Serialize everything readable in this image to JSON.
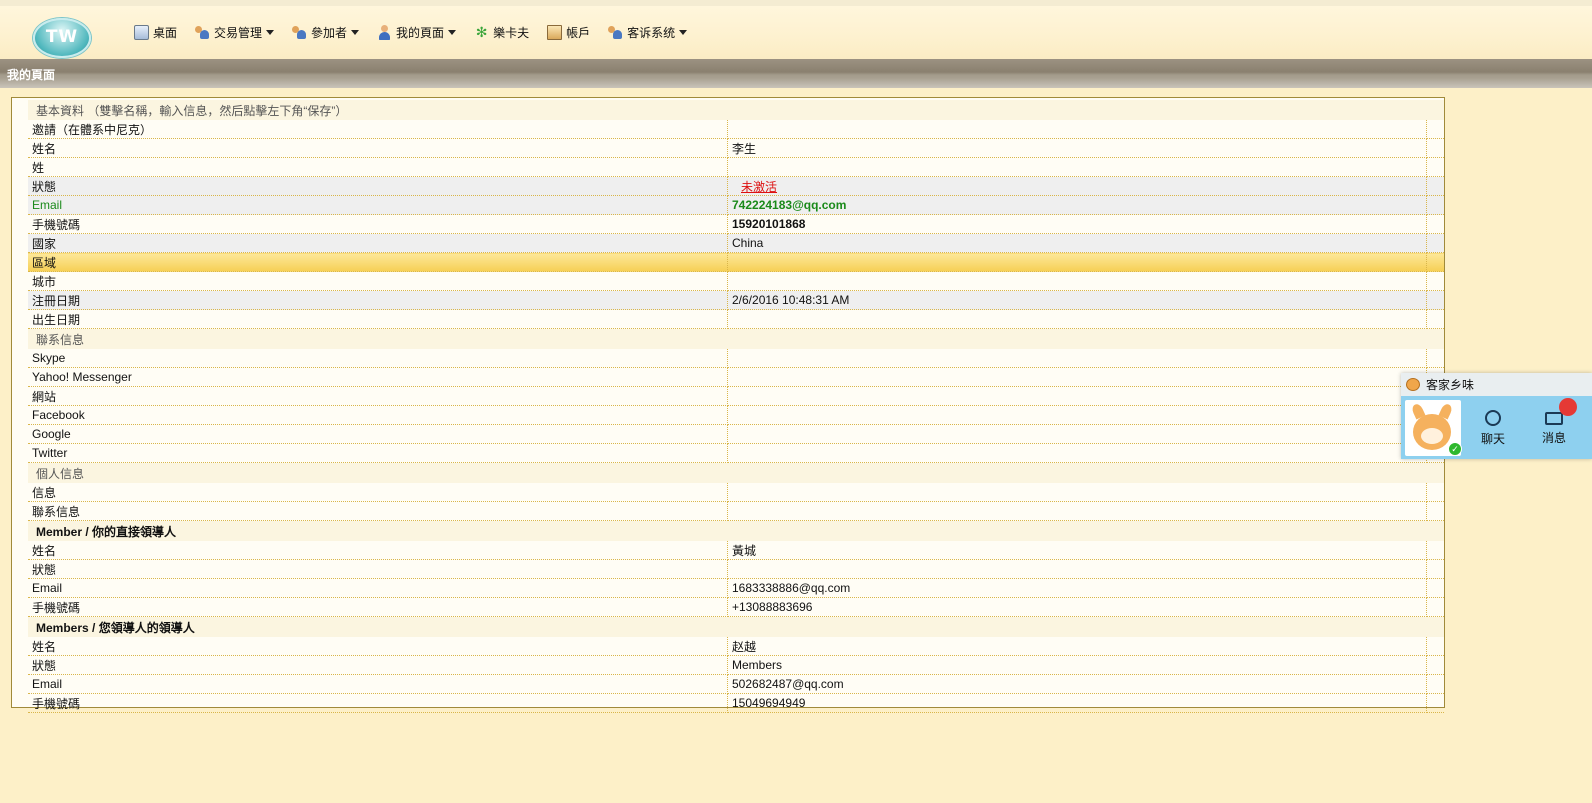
{
  "nav": {
    "logo": "TW",
    "items": [
      {
        "label": "桌面",
        "icon": "desktop-icon",
        "dropdown": false
      },
      {
        "label": "交易管理",
        "icon": "people-icon",
        "dropdown": true
      },
      {
        "label": "參加者",
        "icon": "people-icon",
        "dropdown": true
      },
      {
        "label": "我的頁面",
        "icon": "user-icon",
        "dropdown": true
      },
      {
        "label": "樂卡夫",
        "icon": "butterfly-icon",
        "dropdown": false
      },
      {
        "label": "帳戶",
        "icon": "account-icon",
        "dropdown": false
      },
      {
        "label": "客诉系统",
        "icon": "people-icon",
        "dropdown": true
      }
    ]
  },
  "page_title": "我的頁面",
  "sections": {
    "basic": "基本資料 （雙擊名稱，輸入信息，然后點擊左下角“保存”）",
    "contact": "聯系信息",
    "personal": "個人信息",
    "leader": "Member / 你的直接領導人",
    "leader2": "Members / 您領導人的領導人"
  },
  "basic_rows": [
    {
      "label": "邀請（在體系中尼克）",
      "value": ""
    },
    {
      "label": "姓名",
      "value": "李生"
    },
    {
      "label": "姓",
      "value": ""
    },
    {
      "label": "狀態",
      "value": "未激活"
    },
    {
      "label": "Email",
      "value": "742224183@qq.com"
    },
    {
      "label": "手機號碼",
      "value": "15920101868"
    },
    {
      "label": "國家",
      "value": "China"
    },
    {
      "label": "區域",
      "value": ""
    },
    {
      "label": "城市",
      "value": ""
    },
    {
      "label": "注冊日期",
      "value": "2/6/2016 10:48:31 AM"
    },
    {
      "label": "出生日期",
      "value": ""
    }
  ],
  "contact_rows": [
    {
      "label": "Skype",
      "value": ""
    },
    {
      "label": "Yahoo! Messenger",
      "value": ""
    },
    {
      "label": "網站",
      "value": ""
    },
    {
      "label": "Facebook",
      "value": ""
    },
    {
      "label": "Google",
      "value": ""
    },
    {
      "label": "Twitter",
      "value": ""
    }
  ],
  "personal_rows": [
    {
      "label": "信息",
      "value": ""
    },
    {
      "label": "聯系信息",
      "value": ""
    }
  ],
  "leader_rows": [
    {
      "label": "姓名",
      "value": "黃城"
    },
    {
      "label": "狀態",
      "value": ""
    },
    {
      "label": "Email",
      "value": "1683338886@qq.com"
    },
    {
      "label": "手機號碼",
      "value": "+13088883696"
    }
  ],
  "leader2_rows": [
    {
      "label": "姓名",
      "value": "赵越"
    },
    {
      "label": "狀態",
      "value": "Members"
    },
    {
      "label": "Email",
      "value": "502682487@qq.com"
    },
    {
      "label": "手機號碼",
      "value": "15049694949"
    }
  ],
  "chat_widget": {
    "title": "客家乡味",
    "chat_label": "聊天",
    "message_label": "消息",
    "badge_count": "",
    "colors": {
      "bg": "#8ed0ef",
      "badge": "#e53935"
    }
  },
  "colors": {
    "page_bg": "#fdf0c8",
    "highlight": "#f6cf55",
    "link_red": "#dd1111",
    "email_green": "#1a8a1a"
  }
}
